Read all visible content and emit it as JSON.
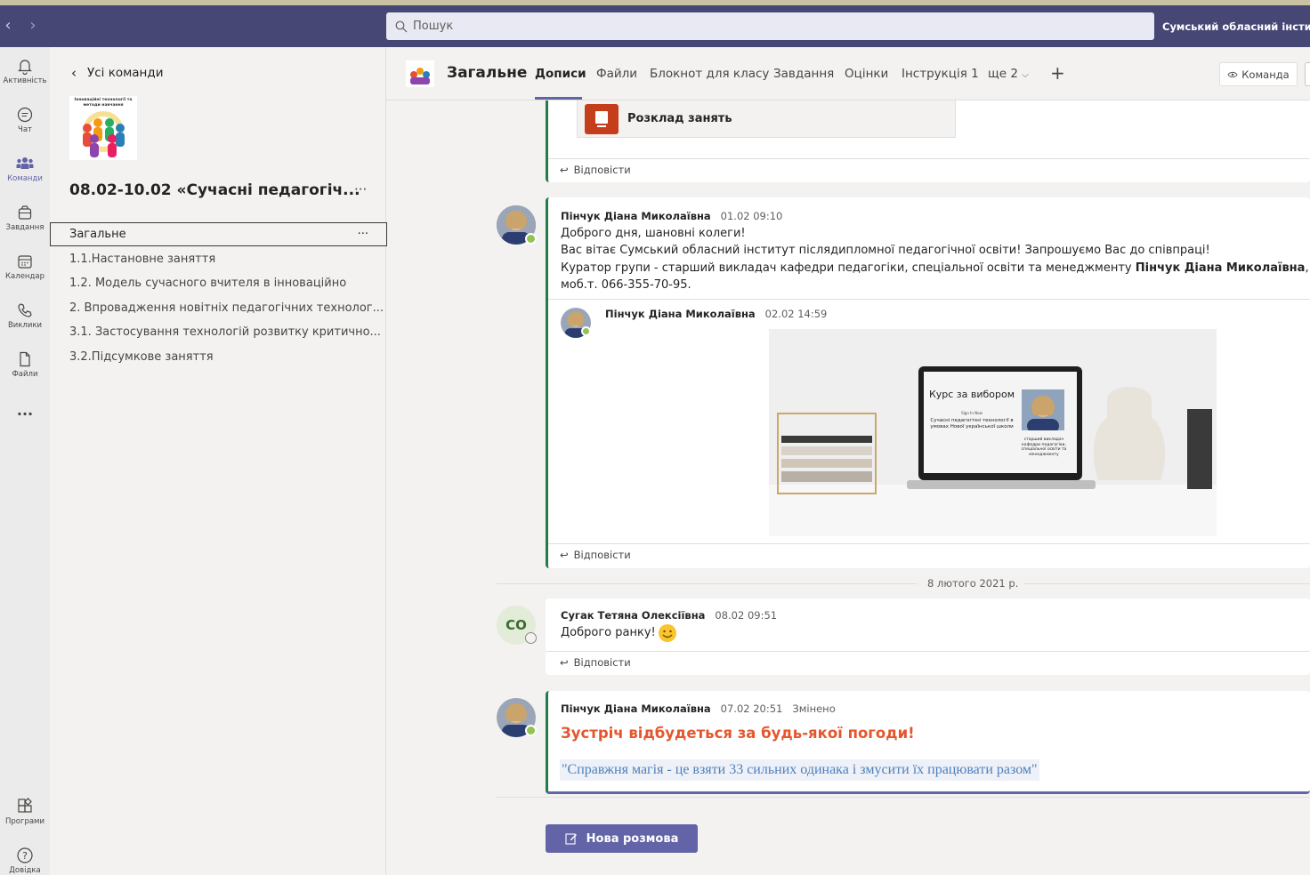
{
  "search": {
    "placeholder": "Пошук"
  },
  "org_name": "Сумський обласний інститут",
  "rail": [
    {
      "label": "Активність",
      "icon": "bell-icon"
    },
    {
      "label": "Чат",
      "icon": "chat-icon"
    },
    {
      "label": "Команди",
      "icon": "teams-icon"
    },
    {
      "label": "Завдання",
      "icon": "assignments-icon"
    },
    {
      "label": "Календар",
      "icon": "calendar-icon"
    },
    {
      "label": "Виклики",
      "icon": "phone-icon"
    },
    {
      "label": "Файли",
      "icon": "file-icon"
    },
    {
      "label": "...",
      "icon": "more-icon"
    },
    {
      "label": "Програми",
      "icon": "apps-icon"
    },
    {
      "label": "Довідка",
      "icon": "help-icon"
    }
  ],
  "sidebar": {
    "back_label": "Усі команди",
    "team_name": "08.02-10.02 «Сучасні педагогіч...",
    "logo_text": "Інноваційні технології та методи навчання",
    "more": "···",
    "channels": [
      "Загальне",
      "1.1.Настановне заняття",
      "1.2. Модель сучасного вчителя в інноваційно",
      "2. Впровадження новітніх педагогічних технолог...",
      "3.1. Застосування технологій розвитку критично...",
      "3.2.Підсумкове заняття"
    ]
  },
  "header": {
    "title": "Загальне",
    "tabs": [
      "Дописи",
      "Файли",
      "Блокнот для класу",
      "Завдання",
      "Оцінки",
      "Інструкція 1",
      "ще 2"
    ],
    "team_button": "Команда",
    "add_tab": "+"
  },
  "posts": {
    "file_card": {
      "name": "Розклад занять"
    },
    "reply_label": "Відповісти",
    "post1": {
      "author": "Пінчук Діана Миколаївна",
      "time": "01.02 09:10",
      "lines": [
        "Доброго дня, шановні колеги!",
        "Вас вітає Сумський обласний інститут післядипломної педагогічної освіти! Запрошуємо Вас до співпраці!",
        "Куратор групи - старший викладач кафедри педагогіки, спеціальної освіти та менеджменту ",
        "моб.т. 066-355-70-95."
      ],
      "bold_name": "Пінчук Діана Миколаївна",
      "after_bold": ","
    },
    "post1_reply": {
      "author": "Пінчук Діана Миколаївна",
      "time": "02.02 14:59",
      "image": {
        "title": "Курс за вибором",
        "signin": "Sign In Now",
        "subtitle": "Сучасні педагогічні технології в умовах Нової української школи",
        "caption": "старший викладач кафедри педагогіки, спеціальної освіти та менеджменту"
      }
    },
    "date_divider": "8 лютого 2021 р.",
    "post2": {
      "initials": "СО",
      "author": "Сугак Тетяна Олексіївна",
      "time": "08.02 09:51",
      "text": "Доброго ранку!"
    },
    "post3": {
      "author": "Пінчук Діана Миколаївна",
      "time": "07.02 20:51",
      "edited": "Змінено",
      "headline": "Зустріч відбудеться за будь-якої погоди!",
      "quote": "\"Справжня магія - це взяти 33 сильних одинака і змусити їх працювати разом\""
    }
  },
  "new_chat": "Нова розмова",
  "colors": {
    "brand": "#6264a7",
    "titlebar": "#464775",
    "accent_green": "#237b4b",
    "headline": "#e4572e",
    "quote": "#4f81bd"
  }
}
